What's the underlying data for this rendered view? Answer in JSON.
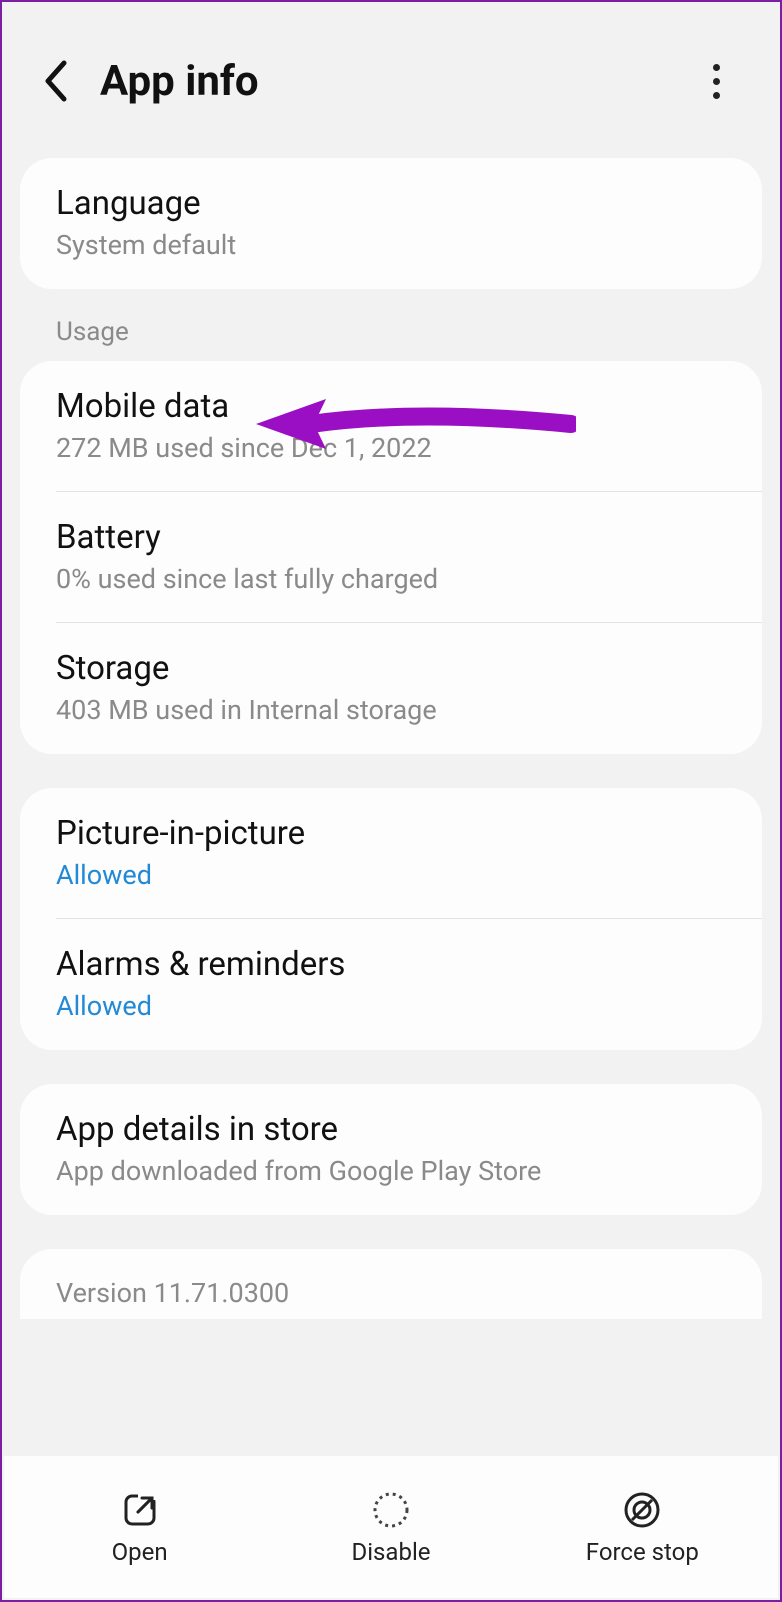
{
  "header": {
    "title": "App info"
  },
  "language": {
    "title": "Language",
    "sub": "System default"
  },
  "usage": {
    "section": "Usage",
    "mobile_data": {
      "title": "Mobile data",
      "sub": "272 MB used since Dec 1, 2022"
    },
    "battery": {
      "title": "Battery",
      "sub": "0% used since last fully charged"
    },
    "storage": {
      "title": "Storage",
      "sub": "403 MB used in Internal storage"
    }
  },
  "perms": {
    "pip": {
      "title": "Picture-in-picture",
      "sub": "Allowed"
    },
    "alarms": {
      "title": "Alarms & reminders",
      "sub": "Allowed"
    }
  },
  "store": {
    "title": "App details in store",
    "sub": "App downloaded from Google Play Store"
  },
  "version": {
    "text": "Version 11.71.0300"
  },
  "bottom": {
    "open": "Open",
    "disable": "Disable",
    "force_stop": "Force stop"
  }
}
